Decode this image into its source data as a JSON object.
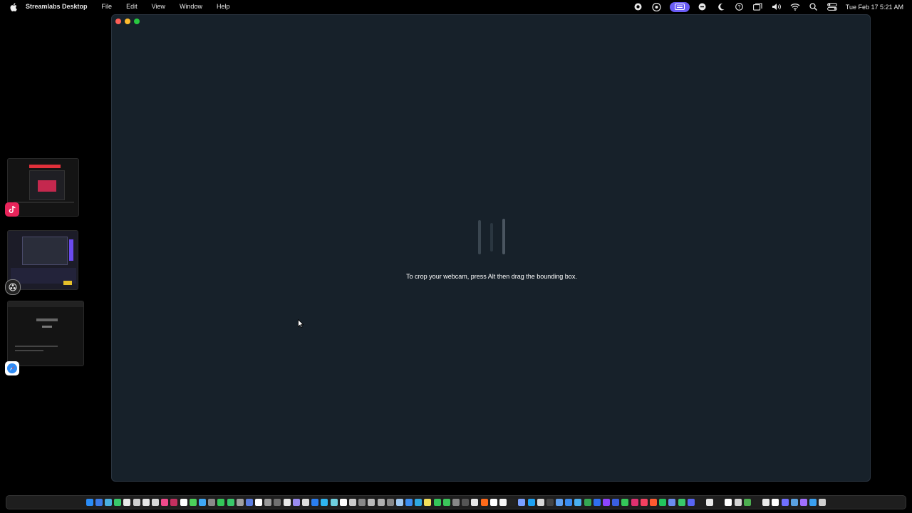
{
  "menubar": {
    "app_name": "Streamlabs Desktop",
    "menus": [
      "File",
      "Edit",
      "View",
      "Window",
      "Help"
    ],
    "clock": "Tue Feb 17  5:21 AM"
  },
  "window": {
    "hint": "To crop your webcam, press Alt then drag the bounding box."
  },
  "stage_manager": {
    "apps": [
      "tiktok-app",
      "obs-app",
      "safari-app"
    ]
  },
  "colors": {
    "window_bg": "#17212a",
    "accent_pill": "#6a5cf5"
  },
  "dock": {
    "icon_colors": [
      "#2a8cf7",
      "#3b7be8",
      "#4ab0e0",
      "#38c86a",
      "#eaeaea",
      "#cfcfcf",
      "#e6e6e6",
      "#d9d9d9",
      "#f14a8c",
      "#c43060",
      "#ffffff",
      "#4cd15a",
      "#3fa8f5",
      "#8a8a8a",
      "#34c759",
      "#38c86a",
      "#a0a0a0",
      "#5b7de0",
      "#ffffff",
      "#9a9a9a",
      "#707070",
      "#e8e8e8",
      "#9a8cf0",
      "#dddddd",
      "#2a7ef0",
      "#2fb5f0",
      "#6fd0e0",
      "#ffffff",
      "#cccccc",
      "#888888",
      "#bbbbbb",
      "#b0b0b0",
      "#888888",
      "#a0c8f0",
      "#3c8ef0",
      "#2fa8e0",
      "#f5e05a",
      "#34c759",
      "#3bc65a",
      "#888888",
      "#555555",
      "#e8e8e8",
      "#ff6a1a",
      "#ffffff",
      "#f5f5f5",
      "#222222",
      "#7aa0ff",
      "#1da1f2",
      "#d8d8d8",
      "#444444",
      "#5fa0f0",
      "#3a8cf0",
      "#4ab0f0",
      "#34a853",
      "#2f6ff0",
      "#8e44ff",
      "#3a5fe0",
      "#34c759",
      "#e03070",
      "#f54060",
      "#ff5a30",
      "#22c55e",
      "#6b8cf0",
      "#38c86a",
      "#5865f2",
      "#1f1f1f",
      "#e8e8e8",
      "#1f1f1f",
      "#ffffff",
      "#d4d4d4",
      "#4caf50",
      "#1f1f1f",
      "#eaeaea",
      "#ffffff",
      "#7070ff",
      "#5aa0e0",
      "#a070ff",
      "#3aa0f0",
      "#d0d0d0"
    ]
  }
}
